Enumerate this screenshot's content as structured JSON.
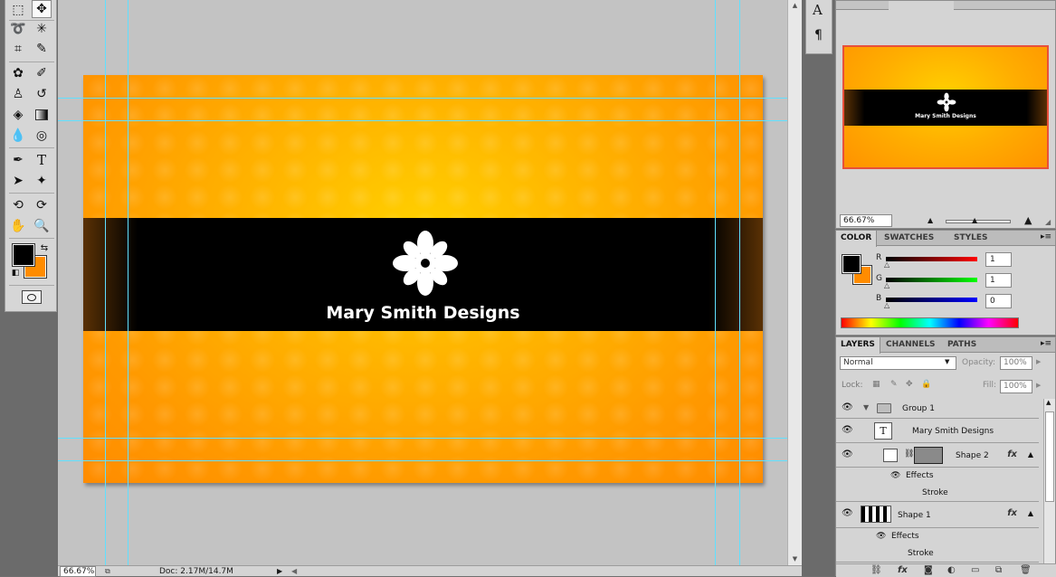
{
  "tools": {
    "type_icon": "T",
    "rows": [
      "marquee-icon",
      "move-icon",
      "lasso-icon",
      "magic-wand-icon",
      "crop-icon",
      "eyedropper-icon",
      "healing-brush-icon",
      "brush-icon",
      "clone-stamp-icon",
      "history-brush-icon",
      "eraser-icon",
      "gradient-icon",
      "blur-icon",
      "dodge-icon",
      "pen-icon",
      "type-icon",
      "path-selection-icon",
      "custom-shape-icon",
      "3d-rotate-icon",
      "3d-orbit-icon",
      "hand-icon",
      "zoom-icon"
    ],
    "foreground_color": "#000000",
    "background_color": "#ff8c00"
  },
  "mini_toolbar": {
    "char_icon": "A",
    "para_icon": "¶"
  },
  "document": {
    "brand_text": "Mary Smith Designs",
    "card_colors": {
      "center": "#ffd000",
      "edge": "#ff8c00",
      "band": "#000000"
    }
  },
  "status_bar": {
    "zoom": "66.67%",
    "doc_info": "Doc: 2.17M/14.7M"
  },
  "navigator": {
    "zoom": "66.67%",
    "brand_text": "Mary Smith Designs",
    "frame_color": "#e8503a"
  },
  "color_panel": {
    "tabs": [
      "COLOR",
      "SWATCHES",
      "STYLES"
    ],
    "r_label": "R",
    "g_label": "G",
    "b_label": "B",
    "r_value": "1",
    "g_value": "1",
    "b_value": "0"
  },
  "layers_panel": {
    "tabs": [
      "LAYERS",
      "CHANNELS",
      "PATHS"
    ],
    "blend_mode": "Normal",
    "opacity_label": "Opacity:",
    "opacity_value": "100%",
    "lock_label": "Lock:",
    "fill_label": "Fill:",
    "fill_value": "100%",
    "layers": {
      "group": "Group 1",
      "text_layer": "Mary Smith Designs",
      "text_thumb": "T",
      "shape2": "Shape 2",
      "shape2_effects": "Effects",
      "shape2_stroke": "Stroke",
      "shape1": "Shape 1",
      "shape1_effects": "Effects",
      "shape1_stroke": "Stroke",
      "fx": "fx"
    }
  }
}
